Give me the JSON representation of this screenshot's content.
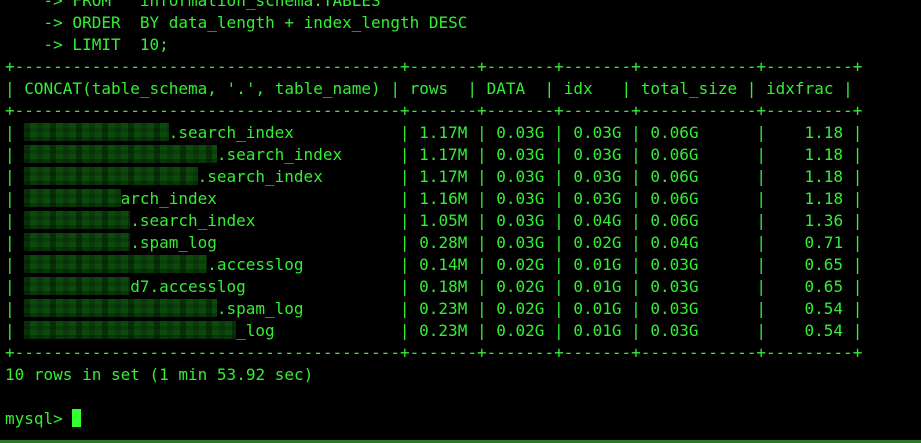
{
  "query": {
    "from_line": "    -> FROM   information_schema.TABLES",
    "order_line": "    -> ORDER  BY data_length + index_length DESC",
    "limit_line": "    -> LIMIT  10;"
  },
  "table": {
    "separator": "+----------------------------------------+-------+-------+-------+------------+---------+",
    "columns": [
      "CONCAT(table_schema, '.', table_name)",
      "rows",
      "DATA",
      "idx",
      "total_size",
      "idxfrac"
    ],
    "rows": [
      {
        "name_suffix": ".search_index",
        "rows": "1.17M",
        "data": "0.03G",
        "idx": "0.03G",
        "total_size": "0.06G",
        "idxfrac": "1.18"
      },
      {
        "name_suffix": ".search_index",
        "rows": "1.17M",
        "data": "0.03G",
        "idx": "0.03G",
        "total_size": "0.06G",
        "idxfrac": "1.18"
      },
      {
        "name_suffix": ".search_index",
        "rows": "1.17M",
        "data": "0.03G",
        "idx": "0.03G",
        "total_size": "0.06G",
        "idxfrac": "1.18"
      },
      {
        "name_suffix": "arch_index",
        "rows": "1.16M",
        "data": "0.03G",
        "idx": "0.03G",
        "total_size": "0.06G",
        "idxfrac": "1.18"
      },
      {
        "name_suffix": ".search_index",
        "rows": "1.05M",
        "data": "0.03G",
        "idx": "0.04G",
        "total_size": "0.06G",
        "idxfrac": "1.36"
      },
      {
        "name_suffix": ".spam_log",
        "rows": "0.28M",
        "data": "0.03G",
        "idx": "0.02G",
        "total_size": "0.04G",
        "idxfrac": "0.71"
      },
      {
        "name_suffix": ".accesslog",
        "rows": "0.14M",
        "data": "0.02G",
        "idx": "0.01G",
        "total_size": "0.03G",
        "idxfrac": "0.65"
      },
      {
        "name_suffix": "d7.accesslog",
        "rows": "0.18M",
        "data": "0.02G",
        "idx": "0.01G",
        "total_size": "0.03G",
        "idxfrac": "0.65"
      },
      {
        "name_suffix": ".spam_log",
        "rows": "0.23M",
        "data": "0.02G",
        "idx": "0.01G",
        "total_size": "0.03G",
        "idxfrac": "0.54"
      },
      {
        "name_suffix": "_log",
        "rows": "0.23M",
        "data": "0.02G",
        "idx": "0.01G",
        "total_size": "0.03G",
        "idxfrac": "0.54"
      }
    ]
  },
  "result_summary": "10 rows in set (1 min 53.92 sec)",
  "prompt": "mysql> ",
  "colors": {
    "background": "#000000",
    "text": "#33ee33",
    "redaction": "#0c4a0c",
    "cursor": "#33ff33"
  }
}
